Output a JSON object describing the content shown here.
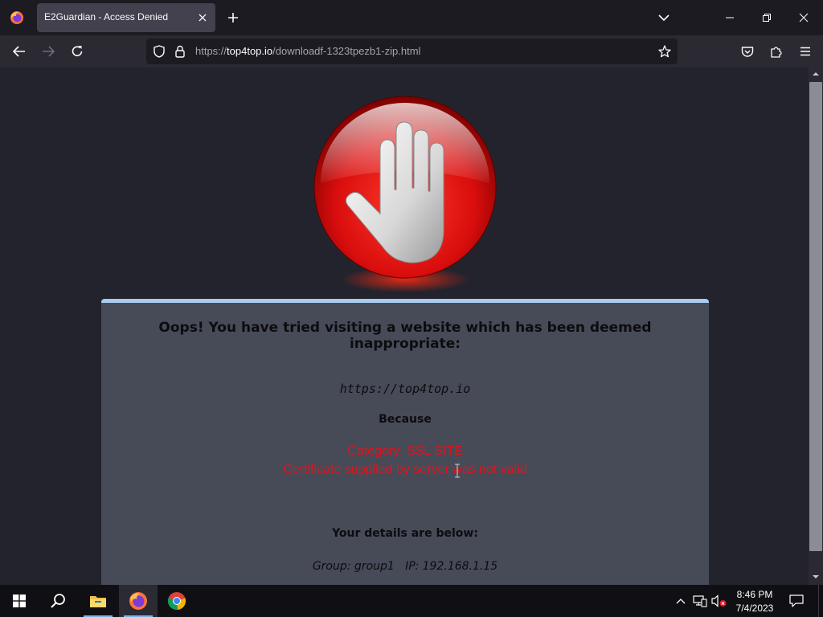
{
  "browser": {
    "tab": {
      "title": "E2Guardian - Access Denied"
    },
    "url": {
      "prefix": "https://",
      "host": "top4top.io",
      "path": "/downloadf-1323tpezb1-zip.html"
    },
    "icons": {
      "app_menu": "firefox-icon",
      "tab_close": "close-icon",
      "new_tab": "plus-icon",
      "list_tabs": "chevron-down-icon",
      "back": "arrow-left-icon",
      "forward": "arrow-right-icon",
      "reload": "reload-icon",
      "tracking_protection": "shield-icon",
      "secure": "lock-icon",
      "bookmark": "star-icon",
      "pocket": "pocket-icon",
      "extensions": "puzzle-icon",
      "menu": "hamburger-icon"
    }
  },
  "page": {
    "heading": "Oops! You have tried visiting a website which has been deemed inappropriate:",
    "blocked_url": "https://top4top.io",
    "because": "Because",
    "category": "Category: SSL SITE",
    "reason": "Certificate supplied by server was not valid",
    "details_heading": "Your details are below:",
    "details_line": "Group: group1   IP: 192.168.1.15",
    "colors": {
      "panel_bg": "#474b57",
      "panel_border": "#a9cbee",
      "alert_text": "#e1131c",
      "page_bg": "#23232d"
    },
    "image": "stop-hand-icon"
  },
  "taskbar": {
    "items": [
      "windows-start-icon",
      "search-icon",
      "file-explorer-icon",
      "firefox-icon",
      "chrome-icon"
    ],
    "clock": {
      "time": "8:46 PM",
      "date": "7/4/2023"
    },
    "tray": [
      "chevron-up-icon",
      "network-icon",
      "volume-muted-icon",
      "notification-icon"
    ]
  }
}
